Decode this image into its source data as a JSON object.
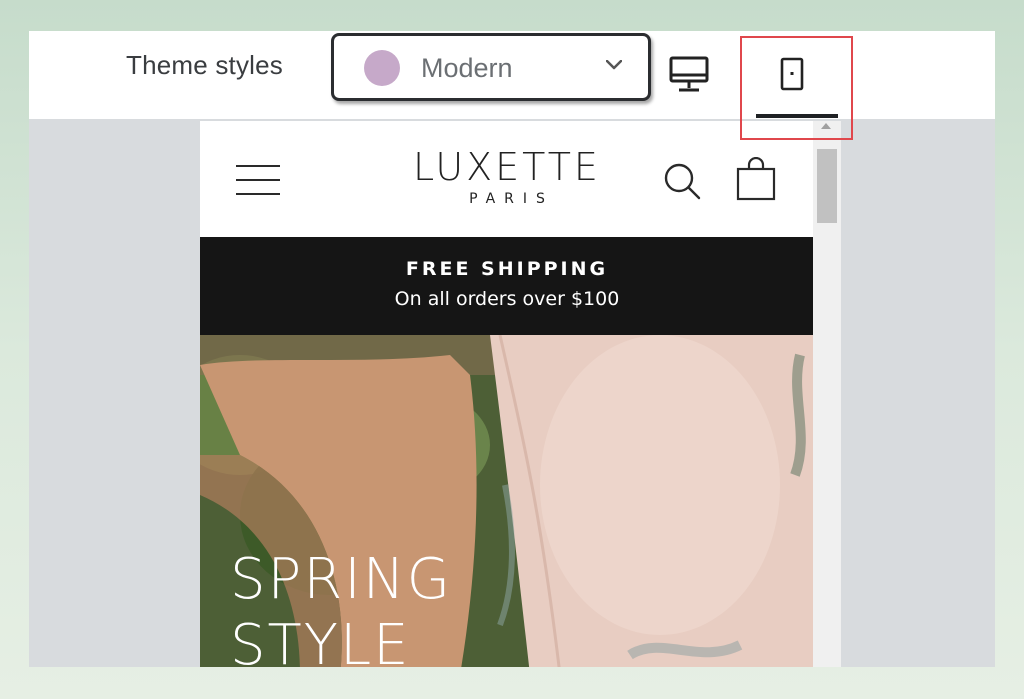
{
  "toolbar": {
    "theme_label": "Theme styles",
    "theme_select": {
      "value": "Modern",
      "swatch_color": "#c6a9c9"
    },
    "view_modes": [
      {
        "name": "desktop",
        "icon": "desktop-icon",
        "active": false
      },
      {
        "name": "mobile",
        "icon": "mobile-icon",
        "active": true
      }
    ],
    "highlight_color": "#e0474c"
  },
  "preview": {
    "logo": {
      "main": "LUXETTE",
      "sub": "PARIS"
    },
    "header_icons": [
      "menu-icon",
      "search-icon",
      "bag-icon"
    ],
    "announcement": {
      "title": "FREE SHIPPING",
      "subtitle": "On all orders over $100"
    },
    "hero": {
      "line1": "SPRING",
      "line2": "STYLE"
    }
  }
}
